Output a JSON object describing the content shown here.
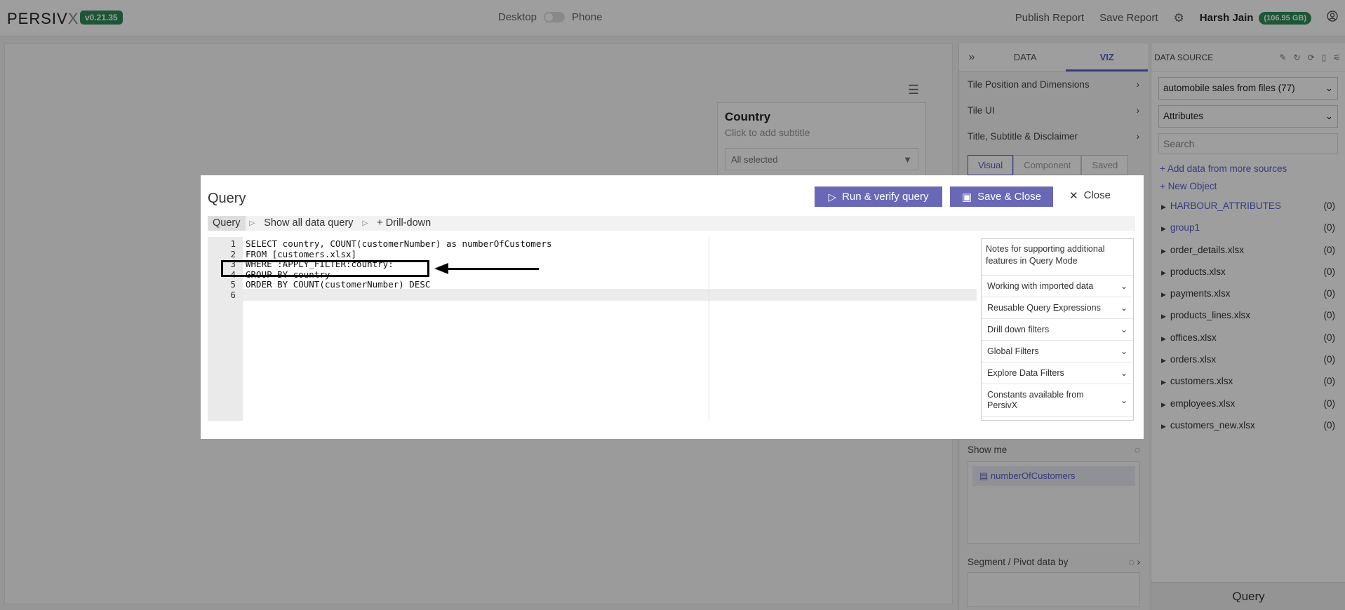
{
  "app": {
    "logo_main": "PERSIV",
    "logo_x": "X",
    "version": "v0.21.35",
    "device_desktop": "Desktop",
    "device_phone": "Phone",
    "publish_report": "Publish Report",
    "save_report": "Save Report",
    "user_name": "Harsh Jain",
    "storage": "(106.95 GB)",
    "accent_color": "#5b5fc7",
    "badge_color": "#2e8b57"
  },
  "tile": {
    "title": "Country",
    "subtitle": "Click to add subtitle",
    "filter_value": "All selected"
  },
  "viz_panel": {
    "tabs": [
      "DATA",
      "VIZ"
    ],
    "rows": [
      "Tile Position and Dimensions",
      "Tile UI",
      "Title, Subtitle & Disclaimer"
    ],
    "sub_tabs": [
      "Visual",
      "Component",
      "Saved"
    ],
    "show_me": "Show me",
    "measure": "numberOfCustomers",
    "segment": "Segment / Pivot data by"
  },
  "data_source": {
    "header": "DATA SOURCE",
    "source_select": "automobile sales from files (77)",
    "attr_select": "Attributes",
    "search_placeholder": "Search",
    "add_data": "Add data from more sources",
    "new_object": "New Object",
    "items": [
      {
        "name": "HARBOUR_ATTRIBUTES",
        "count": "(0)"
      },
      {
        "name": "group1",
        "count": "(0)"
      },
      {
        "name": "order_details.xlsx",
        "count": "(0)"
      },
      {
        "name": "products.xlsx",
        "count": "(0)"
      },
      {
        "name": "payments.xlsx",
        "count": "(0)"
      },
      {
        "name": "products_lines.xlsx",
        "count": "(0)"
      },
      {
        "name": "offices.xlsx",
        "count": "(0)"
      },
      {
        "name": "orders.xlsx",
        "count": "(0)"
      },
      {
        "name": "customers.xlsx",
        "count": "(0)"
      },
      {
        "name": "employees.xlsx",
        "count": "(0)"
      },
      {
        "name": "customers_new.xlsx",
        "count": "(0)"
      }
    ],
    "query_button": "Query"
  },
  "modal": {
    "title": "Query",
    "run_button": "Run & verify query",
    "save_button": "Save & Close",
    "close_button": "Close",
    "tabs": [
      "Query",
      "Show all data query",
      "+ Drill-down"
    ],
    "code_lines": [
      "SELECT country, COUNT(customerNumber) as numberOfCustomers",
      "FROM [customers.xlsx]",
      "WHERE :APPLY_FILTER:country:",
      "GROUP BY country",
      "ORDER BY COUNT(customerNumber) DESC",
      ""
    ],
    "line_numbers": [
      "1",
      "2",
      "3",
      "4",
      "5",
      "6"
    ],
    "notes_header": "Notes for supporting additional features in Query Mode",
    "notes": [
      "Working with imported data",
      "Reusable Query Expressions",
      "Drill down filters",
      "Global Filters",
      "Explore Data Filters",
      "Constants available from PersivX"
    ]
  }
}
